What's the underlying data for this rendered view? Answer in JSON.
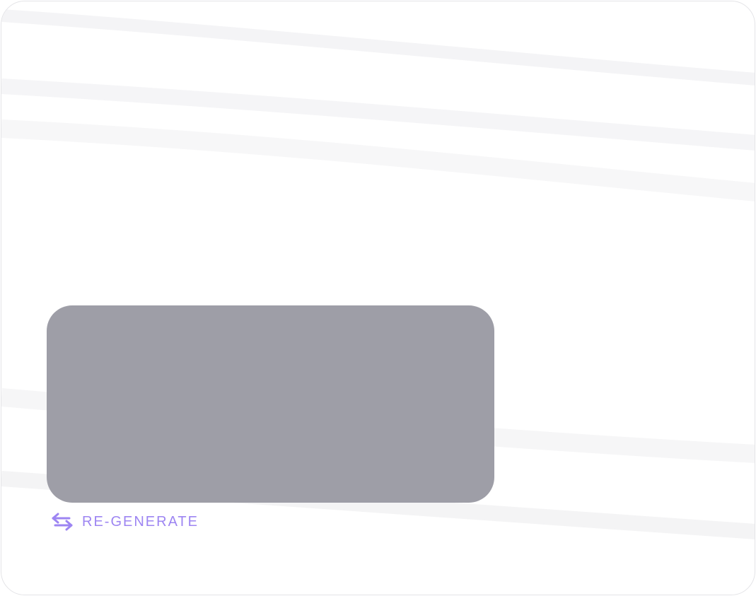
{
  "regenerate": {
    "label": "RE-GENERATE",
    "icon": "swap-arrows-icon",
    "color": "#9d85f2"
  },
  "preview": {
    "placeholder_color": "#9e9ea7"
  }
}
